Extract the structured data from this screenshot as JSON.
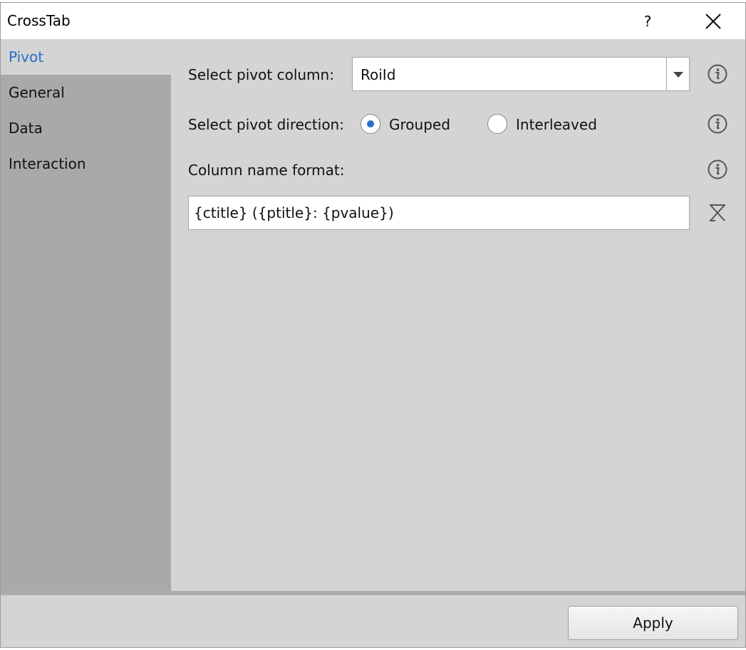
{
  "window": {
    "title": "CrossTab",
    "help_label": "?"
  },
  "sidebar": {
    "items": [
      {
        "label": "Pivot",
        "active": true
      },
      {
        "label": "General"
      },
      {
        "label": "Data"
      },
      {
        "label": "Interaction"
      }
    ]
  },
  "pivot": {
    "column_label": "Select pivot column:",
    "column_value": "RoiId",
    "direction_label": "Select pivot direction:",
    "direction_options": [
      {
        "label": "Grouped",
        "checked": true
      },
      {
        "label": "Interleaved",
        "checked": false
      }
    ],
    "format_label": "Column name format:",
    "format_value": "{ctitle} ({ptitle}: {pvalue})"
  },
  "footer": {
    "apply_label": "Apply"
  },
  "colors": {
    "accent": "#2a6fc4",
    "sidebar_bg": "#a9a9a9",
    "panel_bg": "#d4d4d4"
  },
  "icons": [
    "close-icon",
    "info-icon",
    "reset-icon",
    "dropdown-arrow-icon"
  ]
}
